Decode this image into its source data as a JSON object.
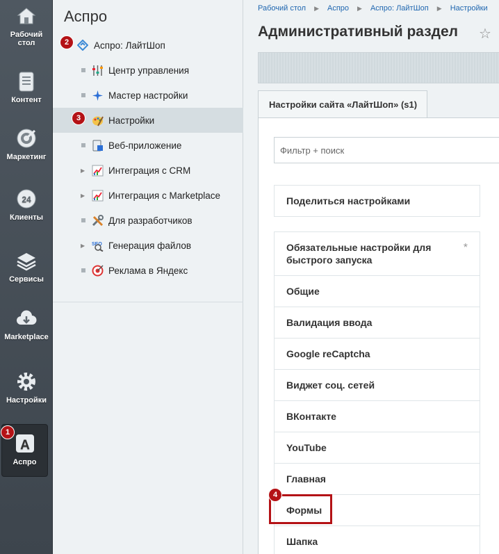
{
  "rail": [
    {
      "label": "Рабочий\nстол",
      "icon": "home-icon"
    },
    {
      "label": "Контент",
      "icon": "document-icon"
    },
    {
      "label": "Маркетинг",
      "icon": "target-icon"
    },
    {
      "label": "Клиенты",
      "icon": "clock-24-icon"
    },
    {
      "label": "Сервисы",
      "icon": "layers-icon"
    },
    {
      "label": "Marketplace",
      "icon": "cloud-download-icon"
    },
    {
      "label": "Настройки",
      "icon": "gear-icon"
    },
    {
      "label": "Аспро",
      "icon": "letter-a-icon"
    }
  ],
  "menu": {
    "title": "Аспро",
    "root": "Аспро: ЛайтШоп",
    "items": [
      {
        "label": "Центр управления",
        "icon": "sliders-icon"
      },
      {
        "label": "Мастер настройки",
        "icon": "sparkle-icon"
      },
      {
        "label": "Настройки",
        "icon": "palette-icon"
      },
      {
        "label": "Веб-приложение",
        "icon": "app-icon"
      },
      {
        "label": "Интеграция с CRM",
        "icon": "chart-icon"
      },
      {
        "label": "Интеграция с Marketplace",
        "icon": "chart-icon"
      },
      {
        "label": "Для разработчиков",
        "icon": "tools-icon"
      },
      {
        "label": "Генерация файлов",
        "icon": "seo-icon"
      },
      {
        "label": "Реклама в Яндекс",
        "icon": "target-ad-icon"
      }
    ]
  },
  "badges": [
    "1",
    "2",
    "3",
    "4"
  ],
  "breadcrumbs": [
    "Рабочий стол",
    "Аспро",
    "Аспро: ЛайтШоп",
    "Настройки"
  ],
  "page_title": "Административный раздел",
  "tab_label": "Настройки сайта «ЛайтШоп» (s1)",
  "search_placeholder": "Фильтр + поиск",
  "share_label": "Поделиться настройками",
  "settings": [
    "Обязательные настройки для быстрого запуска",
    "Общие",
    "Валидация ввода",
    "Google reCaptcha",
    "Виджет соц. сетей",
    "ВКонтакте",
    "YouTube",
    "Главная",
    "Формы",
    "Шапка"
  ],
  "required_mark": "*",
  "colors": {
    "badge": "#b41216",
    "link": "#2067b0",
    "rail": "#4a535b"
  }
}
